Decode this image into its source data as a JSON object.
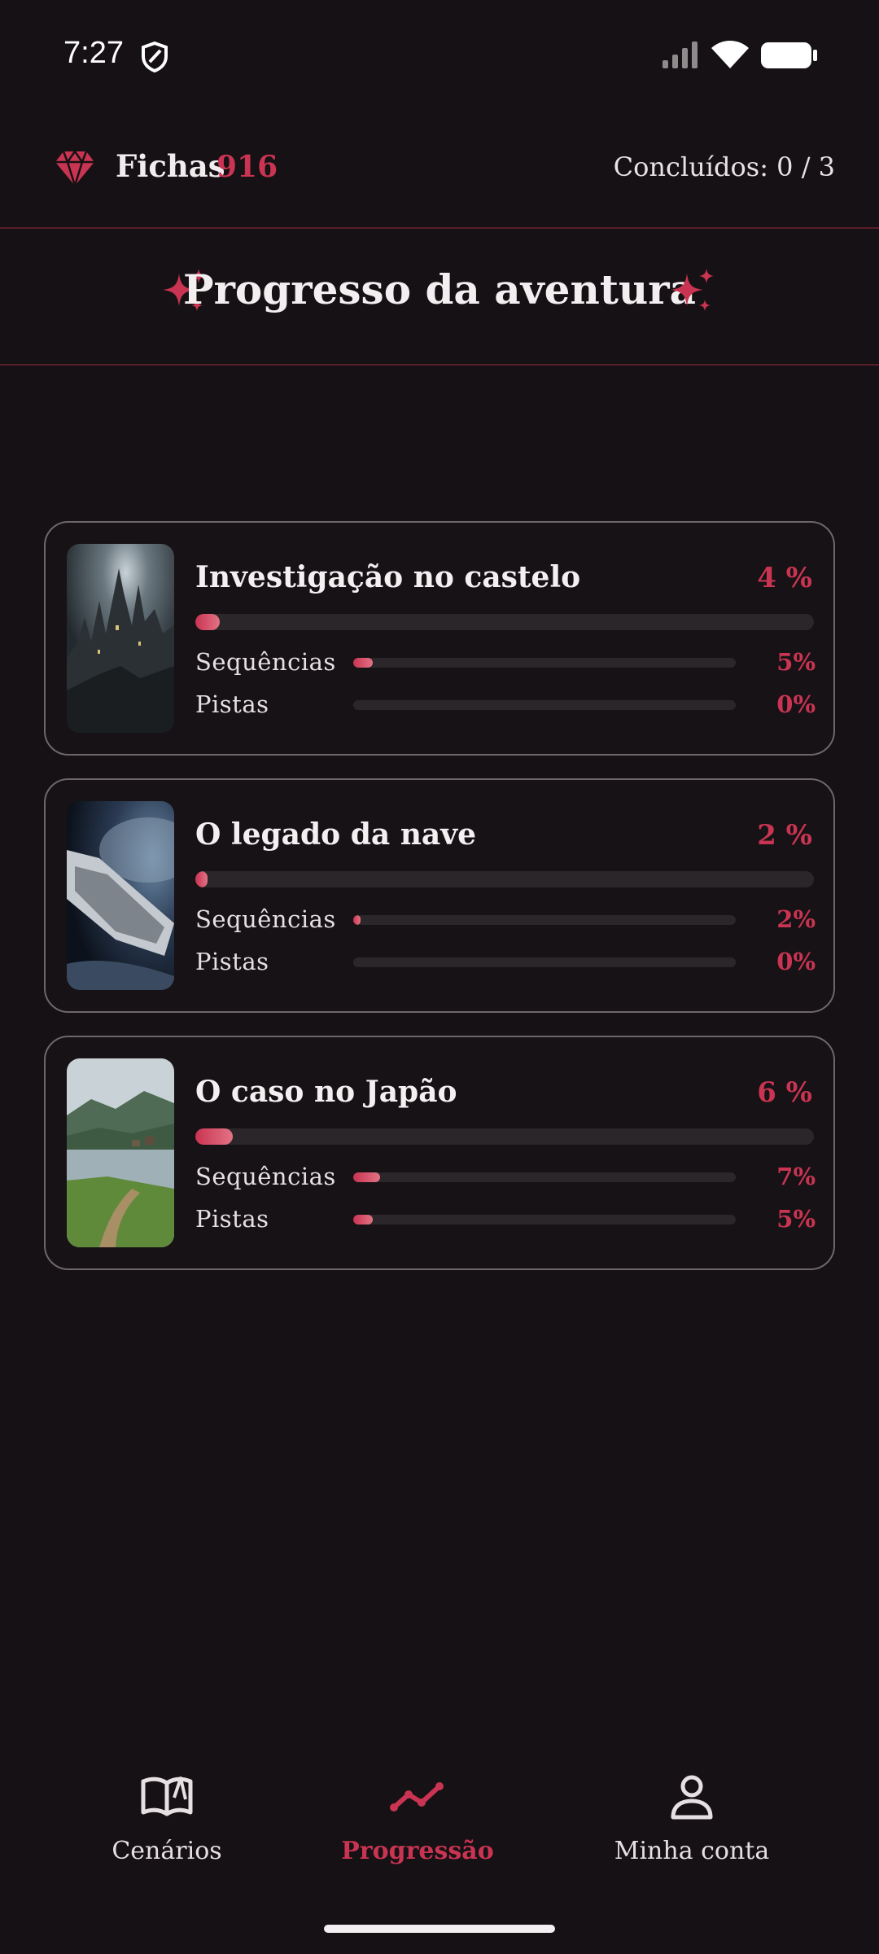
{
  "status_bar": {
    "time": "7:27"
  },
  "header": {
    "tokens_label": "Fichas",
    "tokens_value": "916",
    "completed": "Concluídos: 0 / 3"
  },
  "section_title": "Progresso da aventura",
  "colors": {
    "accent": "#c93452",
    "background": "#151114",
    "card_border": "#6e676a",
    "track": "#2b2629"
  },
  "adventures": [
    {
      "title": "Investigação no castelo",
      "percent_label": "4 %",
      "percent": 4,
      "sequences_label": "Sequências",
      "sequences_value": "5%",
      "sequences": 5,
      "clues_label": "Pistas",
      "clues_value": "0%",
      "clues": 0
    },
    {
      "title": "O legado da nave",
      "percent_label": "2 %",
      "percent": 2,
      "sequences_label": "Sequências",
      "sequences_value": "2%",
      "sequences": 2,
      "clues_label": "Pistas",
      "clues_value": "0%",
      "clues": 0
    },
    {
      "title": "O caso no Japão",
      "percent_label": "6 %",
      "percent": 6,
      "sequences_label": "Sequências",
      "sequences_value": "7%",
      "sequences": 7,
      "clues_label": "Pistas",
      "clues_value": "5%",
      "clues": 5
    }
  ],
  "nav": {
    "items": [
      {
        "label": "Cenários",
        "icon": "book-open-icon",
        "active": false
      },
      {
        "label": "Progressão",
        "icon": "trend-line-icon",
        "active": true
      },
      {
        "label": "Minha conta",
        "icon": "user-icon",
        "active": false
      }
    ]
  }
}
